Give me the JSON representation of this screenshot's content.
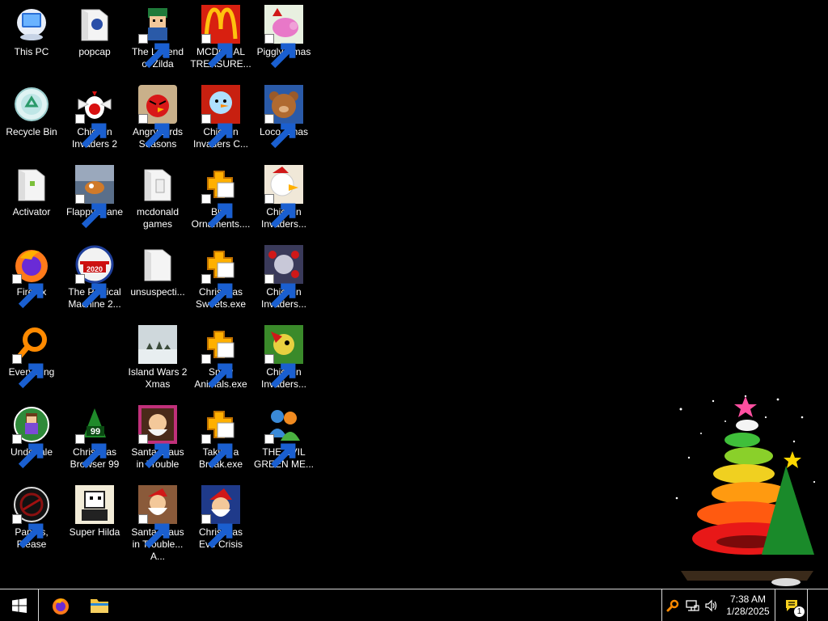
{
  "desktop": {
    "icons": {
      "this_pc": "This PC",
      "recycle_bin": "Recycle Bin",
      "activator": "Activator",
      "firefox": "Firefox",
      "everything": "Everything",
      "undertale": "Undertale",
      "papers_please": "Papers, Please",
      "popcap": "popcap",
      "chicken_invaders_2": "Chicken Invaders 2",
      "flappy_plane": "Flappy Plane",
      "political_machine": "The Political Machine 2...",
      "christmas_browser": "Christmas Browser 99",
      "super_hilda": "Super Hilda",
      "legend_of_zilda": "The Legend of Zilda",
      "angry_birds": "Angry Birds Seasons",
      "mcdonald_games": "mcdonald games",
      "unsuspecti": "unsuspecti...",
      "island_wars": "Island Wars 2 Xmas",
      "santa_claus_trouble": "Santa Claus in Trouble",
      "santa_claus_trouble_a": "Santa Claus in Trouble... A...",
      "mcdonal_treasure": "MCDONAL TREASURE...",
      "chicken_invaders_c": "Chicken Invaders C...",
      "blue_ornaments": "Blue Ornaments....",
      "christmas_sweets": "Christmas Sweets.exe",
      "snow_animals": "Snow Animals.exe",
      "taking_a_break": "Taking a Break.exe",
      "christmas_eve_crisis": "Christmas Eve Crisis",
      "piggly_xmas": "Piggly Xmas",
      "loco_xmas": "Loco Xmas",
      "chicken_invaders_3": "Chicken Invaders...",
      "chicken_invaders_4": "Chicken Invaders...",
      "chicken_invaders_5": "Chicken Invaders...",
      "evil_green_me": "THE EVIL GREEN ME..."
    }
  },
  "taskbar": {
    "clock_time": "7:38 AM",
    "clock_date": "1/28/2025",
    "notification_count": "1"
  }
}
